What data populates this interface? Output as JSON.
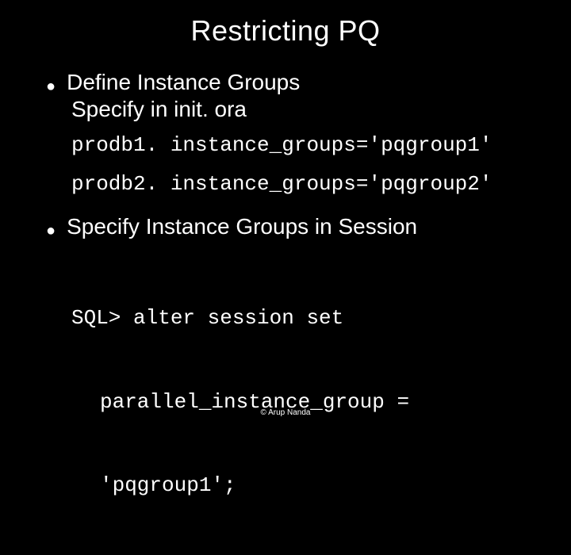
{
  "title": "Restricting PQ",
  "items": [
    {
      "heading": "Define Instance Groups",
      "sub": "Specify in init. ora",
      "code": [
        "prodb1. instance_groups='pqgroup1'",
        "prodb2. instance_groups='pqgroup2'"
      ]
    },
    {
      "heading": "Specify Instance Groups in Session",
      "code_multiline": {
        "l1": "SQL> alter session set",
        "l2": "parallel_instance_group =",
        "l3": "'pqgroup1';"
      }
    }
  ],
  "footer": "© Arup Nanda"
}
